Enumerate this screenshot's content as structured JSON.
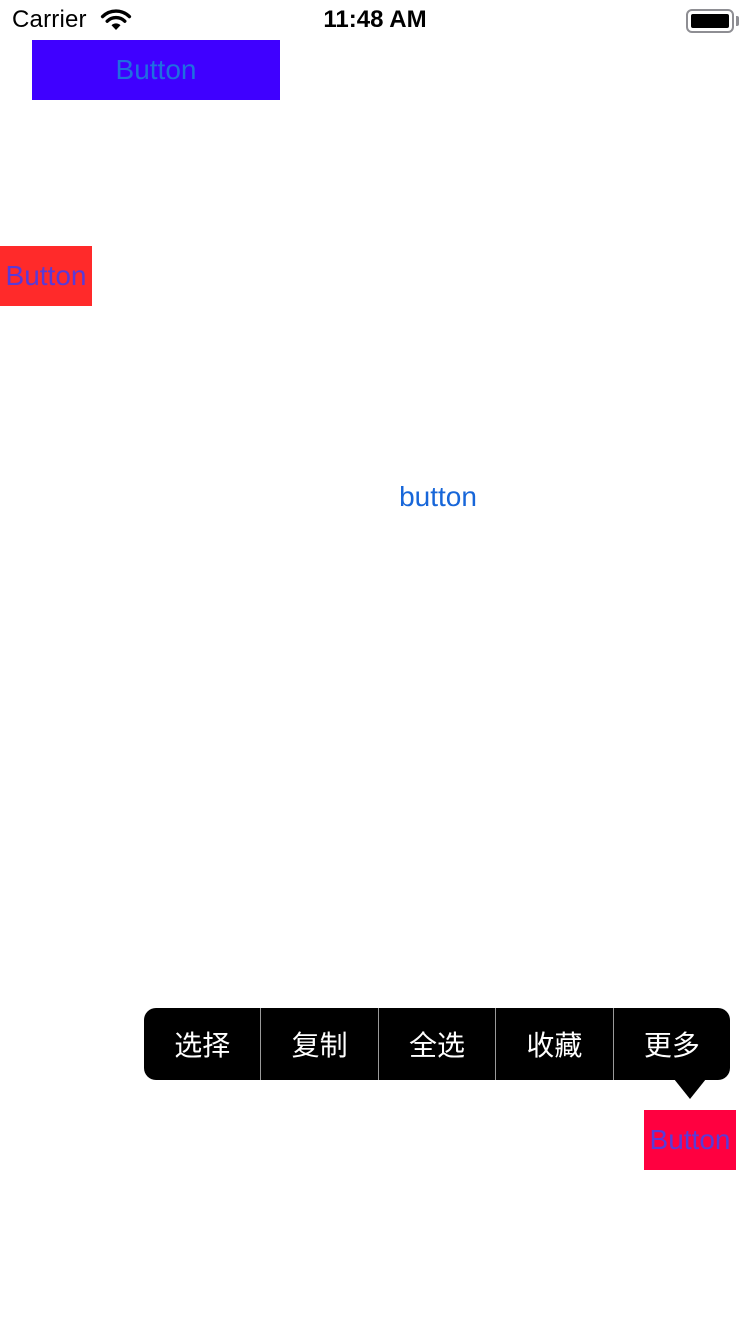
{
  "status_bar": {
    "carrier": "Carrier",
    "time": "11:48 AM",
    "wifi_icon": "wifi-icon",
    "battery_icon": "battery-icon"
  },
  "buttons": {
    "top_label": "Button",
    "top_bg": "#3f00ff",
    "top_text_color": "#1f6fe0",
    "left_label": "Button",
    "left_bg": "#ff2a2a",
    "left_text_color": "#5a3ad6",
    "center_label": "button",
    "center_text_color": "#1766d9",
    "bottom_label": "Button",
    "bottom_bg": "#ff0040",
    "bottom_text_color": "#5a3ad6"
  },
  "edit_menu": {
    "items": [
      "选择",
      "复制",
      "全选",
      "收藏",
      "更多"
    ],
    "bg": "#000000",
    "text_color": "#ffffff"
  }
}
